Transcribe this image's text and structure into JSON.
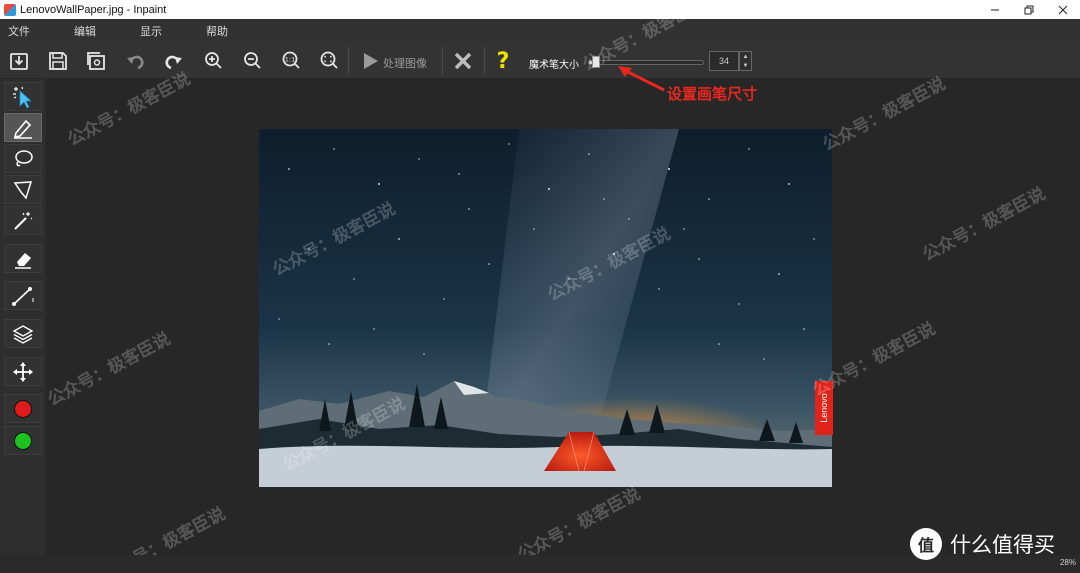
{
  "window": {
    "title": "LenovoWallPaper.jpg - Inpaint"
  },
  "menu": {
    "items": [
      "文件",
      "编辑",
      "显示",
      "帮助"
    ]
  },
  "toolbar": {
    "process_label": "处理图像",
    "brush_size_label": "魔术笔大小",
    "brush_size_value": "34",
    "brush_size_fraction": 0.08,
    "help_glyph": "?"
  },
  "annotation": {
    "text": "设置画笔尺寸"
  },
  "photo": {
    "brand_tag": "Lenovo"
  },
  "watermarks": {
    "text": "公众号：极客臣说"
  },
  "status": {
    "zoom": "28%"
  },
  "branding": {
    "site": "什么值得买",
    "logo_glyph": "值"
  },
  "colors": {
    "accent_red": "#e2231a",
    "brush_red": "#e01b1b",
    "brush_green": "#1ec21e",
    "help_yellow": "#f0e000"
  }
}
